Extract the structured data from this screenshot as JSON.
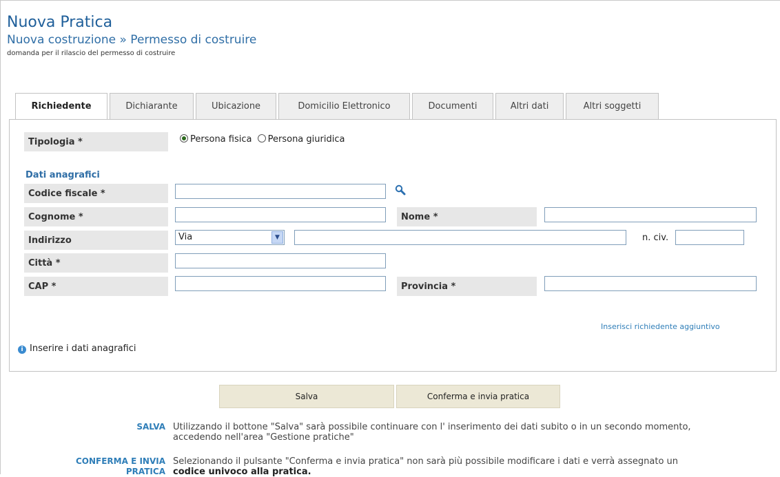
{
  "header": {
    "title": "Nuova Pratica",
    "subtitle": "Nuova costruzione » Permesso di costruire",
    "description": "domanda per il rilascio del permesso di costruire"
  },
  "tabs": [
    {
      "label": "Richiedente",
      "active": true
    },
    {
      "label": "Dichiarante",
      "active": false
    },
    {
      "label": "Ubicazione",
      "active": false
    },
    {
      "label": "Domicilio Elettronico",
      "active": false
    },
    {
      "label": "Documenti",
      "active": false
    },
    {
      "label": "Altri dati",
      "active": false
    },
    {
      "label": "Altri soggetti",
      "active": false
    }
  ],
  "form": {
    "tipologia_label": "Tipologia *",
    "radio_fisica": "Persona fisica",
    "radio_giuridica": "Persona giuridica",
    "selected_tipologia": "Persona fisica",
    "section_title": "Dati anagrafici",
    "codice_fiscale_label": "Codice fiscale *",
    "codice_fiscale_value": "",
    "cognome_label": "Cognome *",
    "cognome_value": "",
    "nome_label": "Nome *",
    "nome_value": "",
    "indirizzo_label": "Indirizzo",
    "indirizzo_type": "Via",
    "indirizzo_value": "",
    "civico_label": "n. civ.",
    "civico_value": "",
    "citta_label": "Città *",
    "citta_value": "",
    "cap_label": "CAP *",
    "cap_value": "",
    "provincia_label": "Provincia *",
    "provincia_value": "",
    "add_link": "Inserisci richiedente aggiuntivo",
    "info_text": "Inserire i dati anagrafici"
  },
  "buttons": {
    "salva": "Salva",
    "conferma": "Conferma e invia pratica"
  },
  "help": {
    "salva_key": "SALVA",
    "salva_text": "Utilizzando il bottone \"Salva\" sarà possibile continuare con l' inserimento dei dati subito o in un secondo momento,",
    "salva_text2": "accedendo nell'area \"Gestione pratiche\"",
    "conferma_key_line1": "CONFERMA E INVIA",
    "conferma_key_line2": "PRATICA",
    "conferma_text": "Selezionando il pulsante \"Conferma e invia pratica\" non sarà più possibile modificare i dati e verrà assegnato un",
    "conferma_text2": "codice univoco alla pratica."
  },
  "icons": {
    "search": "search-icon",
    "info": "info-icon",
    "select_arrow": "chevron-down-icon"
  },
  "colors": {
    "accent": "#2f6ea6",
    "label_bg": "#e7e7e7",
    "button_bg": "#ece8d6"
  }
}
